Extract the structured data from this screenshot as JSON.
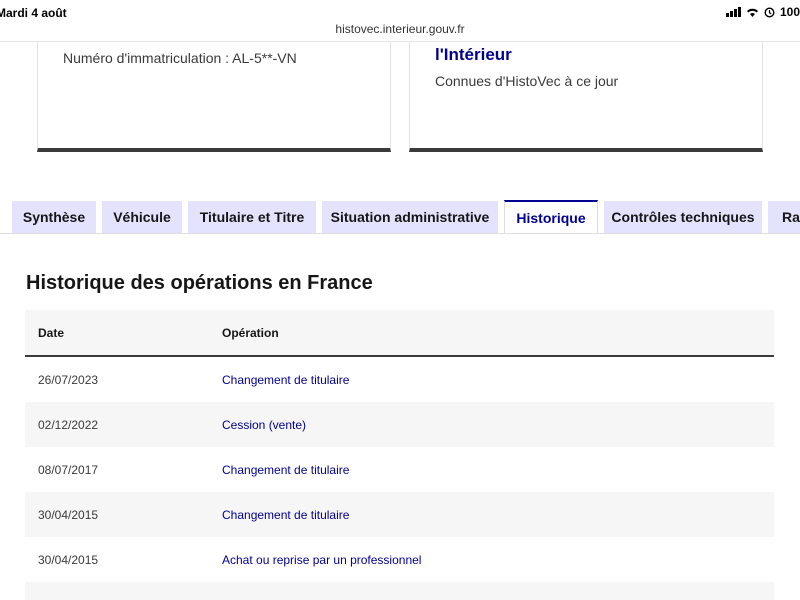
{
  "status_bar": {
    "date": "Mardi 4 août",
    "battery": "100",
    "icons": [
      "signal-icon",
      "wifi-icon",
      "alarm-icon"
    ]
  },
  "url": "histovec.interieur.gouv.fr",
  "card_left": {
    "text": "Numéro d'immatriculation : AL-5**-VN"
  },
  "card_right": {
    "title": "l'Intérieur",
    "subtitle": "Connues d'HistoVec à ce jour"
  },
  "tabs": [
    {
      "label": "Synthèse",
      "active": false
    },
    {
      "label": "Véhicule",
      "active": false
    },
    {
      "label": "Titulaire et Titre",
      "active": false
    },
    {
      "label": "Situation administrative",
      "active": false
    },
    {
      "label": "Historique",
      "active": true
    },
    {
      "label": "Contrôles techniques",
      "active": false
    },
    {
      "label": "Rap",
      "active": false
    }
  ],
  "section": {
    "title": "Historique des opérations en France",
    "headers": {
      "date": "Date",
      "operation": "Opération"
    },
    "rows": [
      {
        "date": "26/07/2023",
        "operation": "Changement de titulaire"
      },
      {
        "date": "02/12/2022",
        "operation": "Cession (vente)"
      },
      {
        "date": "08/07/2017",
        "operation": "Changement de titulaire"
      },
      {
        "date": "30/04/2015",
        "operation": "Changement de titulaire"
      },
      {
        "date": "30/04/2015",
        "operation": "Achat ou reprise par un professionnel"
      },
      {
        "date": "",
        "operation": ""
      }
    ]
  },
  "colors": {
    "accent": "#000091",
    "tab_bg": "#e3e3fd",
    "text": "#161616"
  }
}
